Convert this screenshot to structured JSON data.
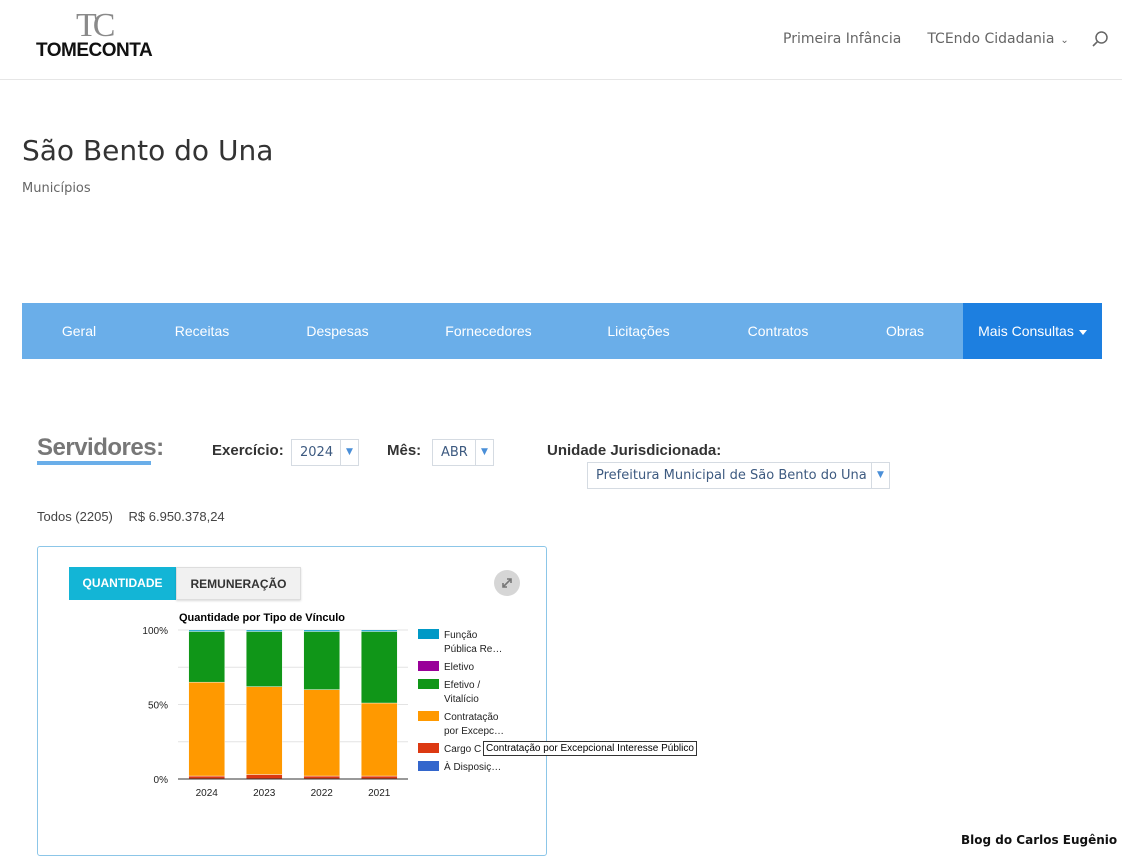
{
  "header": {
    "logo_tc": "TC",
    "logo_word": "TOMECONTA",
    "nav": [
      {
        "label": "Primeira Infância"
      },
      {
        "label": "TCEndo Cidadania"
      }
    ],
    "search_icon": "search-icon"
  },
  "page": {
    "title": "São Bento do Una",
    "subtitle": "Municípios"
  },
  "main_nav": {
    "items": [
      "Geral",
      "Receitas",
      "Despesas",
      "Fornecedores",
      "Licitações",
      "Contratos",
      "Obras"
    ],
    "more": "Mais Consultas",
    "colors": {
      "bar": "#6aaee9",
      "active": "#1d7fe0"
    }
  },
  "filters": {
    "heading": "Servidores:",
    "exercicio_label": "Exercício:",
    "exercicio_value": "2024",
    "mes_label": "Mês:",
    "mes_value": "ABR",
    "unidade_label": "Unidade Jurisdicionada:",
    "unidade_value": "Prefeitura Municipal de São Bento do Una"
  },
  "summary": {
    "todos": "Todos (2205)",
    "valor": "R$ 6.950.378,24"
  },
  "panel": {
    "tabs": [
      "QUANTIDADE",
      "REMUNERAÇÃO"
    ],
    "active_tab": "QUANTIDADE",
    "expand_icon": "expand-icon"
  },
  "tooltip": "Contratação por Excepcional Interesse Público",
  "watermark": "Blog do Carlos Eugênio",
  "chart_data": {
    "type": "bar",
    "stacked": "percent",
    "title": "Quantidade por Tipo de Vínculo",
    "categories": [
      "2024",
      "2023",
      "2022",
      "2021"
    ],
    "y_ticks": [
      "0%",
      "50%",
      "100%"
    ],
    "ylim": [
      0,
      100
    ],
    "series": [
      {
        "name": "À Disposiç…",
        "color": "#3366cc",
        "values": [
          0,
          0,
          0,
          0
        ]
      },
      {
        "name": "Cargo C…",
        "color": "#dc3912",
        "values": [
          2,
          3,
          2,
          2
        ]
      },
      {
        "name": "Contratação por Excepc…",
        "color": "#ff9900",
        "values": [
          63,
          59,
          58,
          49
        ]
      },
      {
        "name": "Efetivo / Vitalício",
        "color": "#109618",
        "values": [
          34,
          37,
          39,
          48
        ]
      },
      {
        "name": "Eletivo",
        "color": "#990099",
        "values": [
          0,
          0,
          0,
          0
        ]
      },
      {
        "name": "Função Pública Re…",
        "color": "#0099c6",
        "values": [
          1,
          1,
          1,
          1
        ]
      }
    ],
    "legend": [
      {
        "lines": [
          "Função",
          "Pública Re…"
        ],
        "color": "#0099c6"
      },
      {
        "lines": [
          "Eletivo"
        ],
        "color": "#990099"
      },
      {
        "lines": [
          "Efetivo /",
          "Vitalício"
        ],
        "color": "#109618"
      },
      {
        "lines": [
          "Contratação",
          "por Excepc…"
        ],
        "color": "#ff9900"
      },
      {
        "lines": [
          "Cargo C"
        ],
        "color": "#dc3912"
      },
      {
        "lines": [
          "À Disposiç…"
        ],
        "color": "#3366cc"
      }
    ],
    "legend_position": "right",
    "grid": true
  }
}
